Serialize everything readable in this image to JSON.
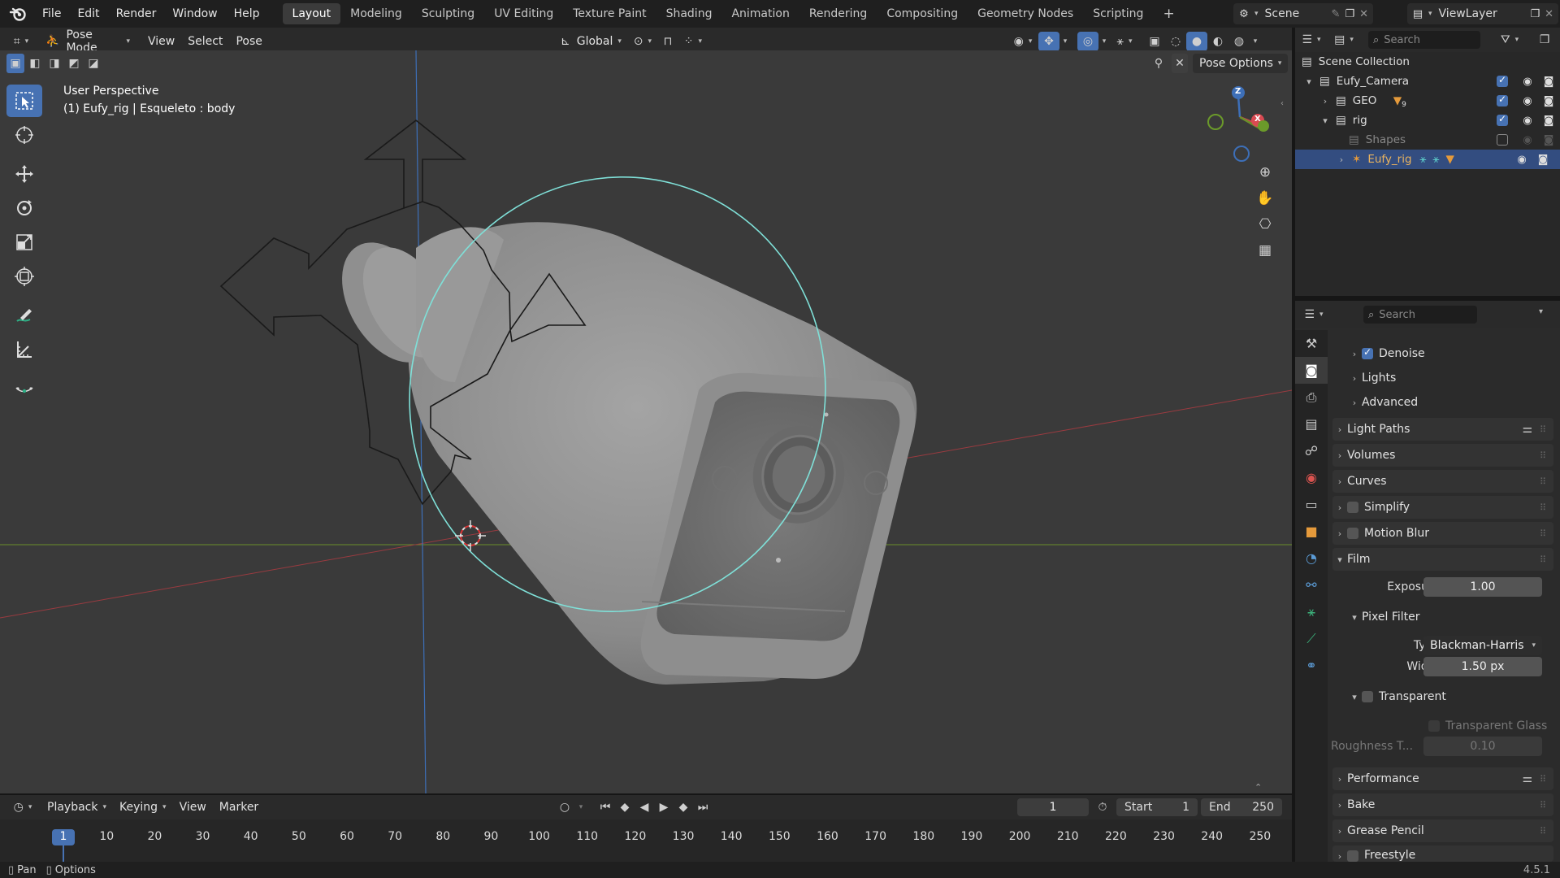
{
  "topbar": {
    "menus": [
      "File",
      "Edit",
      "Render",
      "Window",
      "Help"
    ],
    "workspaces": [
      "Layout",
      "Modeling",
      "Sculpting",
      "UV Editing",
      "Texture Paint",
      "Shading",
      "Animation",
      "Rendering",
      "Compositing",
      "Geometry Nodes",
      "Scripting"
    ],
    "active_workspace": "Layout",
    "add_tab": "+",
    "scene": "Scene",
    "view_layer": "ViewLayer"
  },
  "viewport_header": {
    "mode": "Pose Mode",
    "menus": [
      "View",
      "Select",
      "Pose"
    ],
    "transform_orientation": "Global",
    "pose_options": "Pose Options"
  },
  "viewport": {
    "perspective": "User Perspective",
    "object_info": "(1) Eufy_rig | Esqueleto : body",
    "gizmo_axes": {
      "z": "Z",
      "x": "X"
    }
  },
  "outliner": {
    "search_placeholder": "Search",
    "scene_collection": "Scene Collection",
    "items": [
      {
        "label": "Eufy_Camera",
        "depth": 0,
        "expanded": true
      },
      {
        "label": "GEO",
        "depth": 1,
        "expanded": false,
        "badge": "9"
      },
      {
        "label": "rig",
        "depth": 1,
        "expanded": true
      },
      {
        "label": "Shapes",
        "depth": 2,
        "expanded": false,
        "dimmed": true
      },
      {
        "label": "Eufy_rig",
        "depth": 2,
        "expanded": false,
        "selected": true
      }
    ]
  },
  "properties": {
    "search_placeholder": "Search",
    "rows": {
      "denoise": "Denoise",
      "lights": "Lights",
      "advanced": "Advanced",
      "light_paths": "Light Paths",
      "volumes": "Volumes",
      "curves": "Curves",
      "simplify": "Simplify",
      "motion_blur": "Motion Blur",
      "film": "Film",
      "exposure_label": "Exposure",
      "exposure_value": "1.00",
      "pixel_filter": "Pixel Filter",
      "type_label": "Type",
      "type_value": "Blackman-Harris",
      "width_label": "Width",
      "width_value": "1.50 px",
      "transparent": "Transparent",
      "transparent_glass": "Transparent Glass",
      "roughness_label": "Roughness T...",
      "roughness_value": "0.10",
      "performance": "Performance",
      "bake": "Bake",
      "grease_pencil": "Grease Pencil",
      "freestyle": "Freestyle"
    }
  },
  "timeline": {
    "menus": [
      "Playback",
      "Keying",
      "View",
      "Marker"
    ],
    "current_frame": "1",
    "start_label": "Start",
    "start_value": "1",
    "end_label": "End",
    "end_value": "250",
    "ticks": [
      "1",
      "10",
      "20",
      "30",
      "40",
      "50",
      "60",
      "70",
      "80",
      "90",
      "100",
      "110",
      "120",
      "130",
      "140",
      "150",
      "160",
      "170",
      "180",
      "190",
      "200",
      "210",
      "220",
      "230",
      "240",
      "250"
    ]
  },
  "statusbar": {
    "pan": "Pan",
    "options": "Options",
    "version": "4.5.1"
  },
  "colors": {
    "accent": "#4772b3",
    "selection_circle": "#7fe0d8",
    "x_axis": "#c8474d",
    "y_axis": "#6b8f2a",
    "z_axis": "#3d6fb8"
  }
}
